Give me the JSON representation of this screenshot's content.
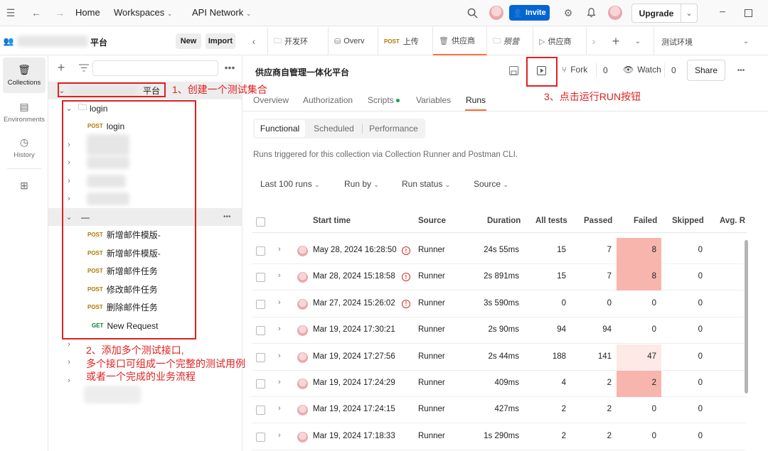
{
  "topbar": {
    "home": "Home",
    "workspaces": "Workspaces",
    "api_network": "API Network",
    "invite": "Invite",
    "upgrade": "Upgrade"
  },
  "workspace": {
    "name_suffix": "平台",
    "new_button": "New",
    "import_button": "Import"
  },
  "leftnav": {
    "items": [
      {
        "label": "Collections",
        "icon": "collections-icon"
      },
      {
        "label": "Environments",
        "icon": "environments-icon"
      },
      {
        "label": "History",
        "icon": "history-icon"
      }
    ]
  },
  "tree": {
    "collection_suffix": "平台",
    "folder_login": "login",
    "items": [
      {
        "method": "POST",
        "name": "login"
      },
      {
        "method": "POST",
        "name": "新增邮件模版-"
      },
      {
        "method": "POST",
        "name": "新增邮件模版-"
      },
      {
        "method": "POST",
        "name": "新增邮件任务"
      },
      {
        "method": "POST",
        "name": "修改邮件任务"
      },
      {
        "method": "POST",
        "name": "删除邮件任务"
      },
      {
        "method": "GET",
        "name": "New Request"
      }
    ],
    "folder_dash": "—"
  },
  "annotations": {
    "a1": "1、创建一个测试集合",
    "a2_line1": "2、添加多个测试接口,",
    "a2_line2": "多个接口可组成一个完整的测试用例",
    "a2_line3": "或者一个完成的业务流程",
    "a3": "3、点击运行RUN按钮"
  },
  "tabs": [
    {
      "label": "开发环"
    },
    {
      "label": "Overv"
    },
    {
      "method": "POST",
      "label": "上传"
    },
    {
      "label": "供应商"
    },
    {
      "label": "殒营"
    },
    {
      "label": "供应商"
    }
  ],
  "tabs_extra": {
    "env": "测试环境"
  },
  "collection": {
    "title": "供应商自管理一体化平台",
    "fork": "Fork",
    "fork_count": "0",
    "watch": "Watch",
    "watch_count": "0",
    "share": "Share"
  },
  "subtabs": [
    "Overview",
    "Authorization",
    "Scripts",
    "Variables",
    "Runs"
  ],
  "segments": [
    "Functional",
    "Scheduled",
    "Performance"
  ],
  "runs_info": "Runs triggered for this collection via Collection Runner and Postman CLI.",
  "filters": [
    "Last 100 runs",
    "Run by",
    "Run status",
    "Source"
  ],
  "table": {
    "headers": [
      "Start time",
      "Source",
      "Duration",
      "All tests",
      "Passed",
      "Failed",
      "Skipped",
      "Avg. R"
    ],
    "rows": [
      {
        "time": "May 28, 2024 16:28:50",
        "warn": true,
        "source": "Runner",
        "duration": "24s 55ms",
        "all": "15",
        "passed": "7",
        "failed": "8",
        "skipped": "0",
        "fail_level": "high"
      },
      {
        "time": "Mar 28, 2024 15:18:58",
        "warn": true,
        "source": "Runner",
        "duration": "2s 891ms",
        "all": "15",
        "passed": "7",
        "failed": "8",
        "skipped": "0",
        "fail_level": "high"
      },
      {
        "time": "Mar 27, 2024 15:26:02",
        "warn": true,
        "source": "Runner",
        "duration": "3s 590ms",
        "all": "0",
        "passed": "0",
        "failed": "0",
        "skipped": "0",
        "fail_level": "none"
      },
      {
        "time": "Mar 19, 2024 17:30:21",
        "warn": false,
        "source": "Runner",
        "duration": "2s 90ms",
        "all": "94",
        "passed": "94",
        "failed": "0",
        "skipped": "0",
        "fail_level": "none"
      },
      {
        "time": "Mar 19, 2024 17:27:56",
        "warn": false,
        "source": "Runner",
        "duration": "2s 44ms",
        "all": "188",
        "passed": "141",
        "failed": "47",
        "skipped": "0",
        "fail_level": "low"
      },
      {
        "time": "Mar 19, 2024 17:24:29",
        "warn": false,
        "source": "Runner",
        "duration": "409ms",
        "all": "4",
        "passed": "2",
        "failed": "2",
        "skipped": "0",
        "fail_level": "high"
      },
      {
        "time": "Mar 19, 2024 17:24:15",
        "warn": false,
        "source": "Runner",
        "duration": "427ms",
        "all": "2",
        "passed": "2",
        "failed": "0",
        "skipped": "0",
        "fail_level": "none"
      },
      {
        "time": "Mar 19, 2024 17:18:33",
        "warn": false,
        "source": "Runner",
        "duration": "1s 290ms",
        "all": "2",
        "passed": "2",
        "failed": "0",
        "skipped": "0",
        "fail_level": "none"
      }
    ]
  },
  "colors": {
    "accent": "#ff6c37",
    "invite_blue": "#0265d2",
    "fail_high": "#f7b5ad",
    "fail_low": "#fde9e5",
    "annotation_red": "#e02020"
  }
}
